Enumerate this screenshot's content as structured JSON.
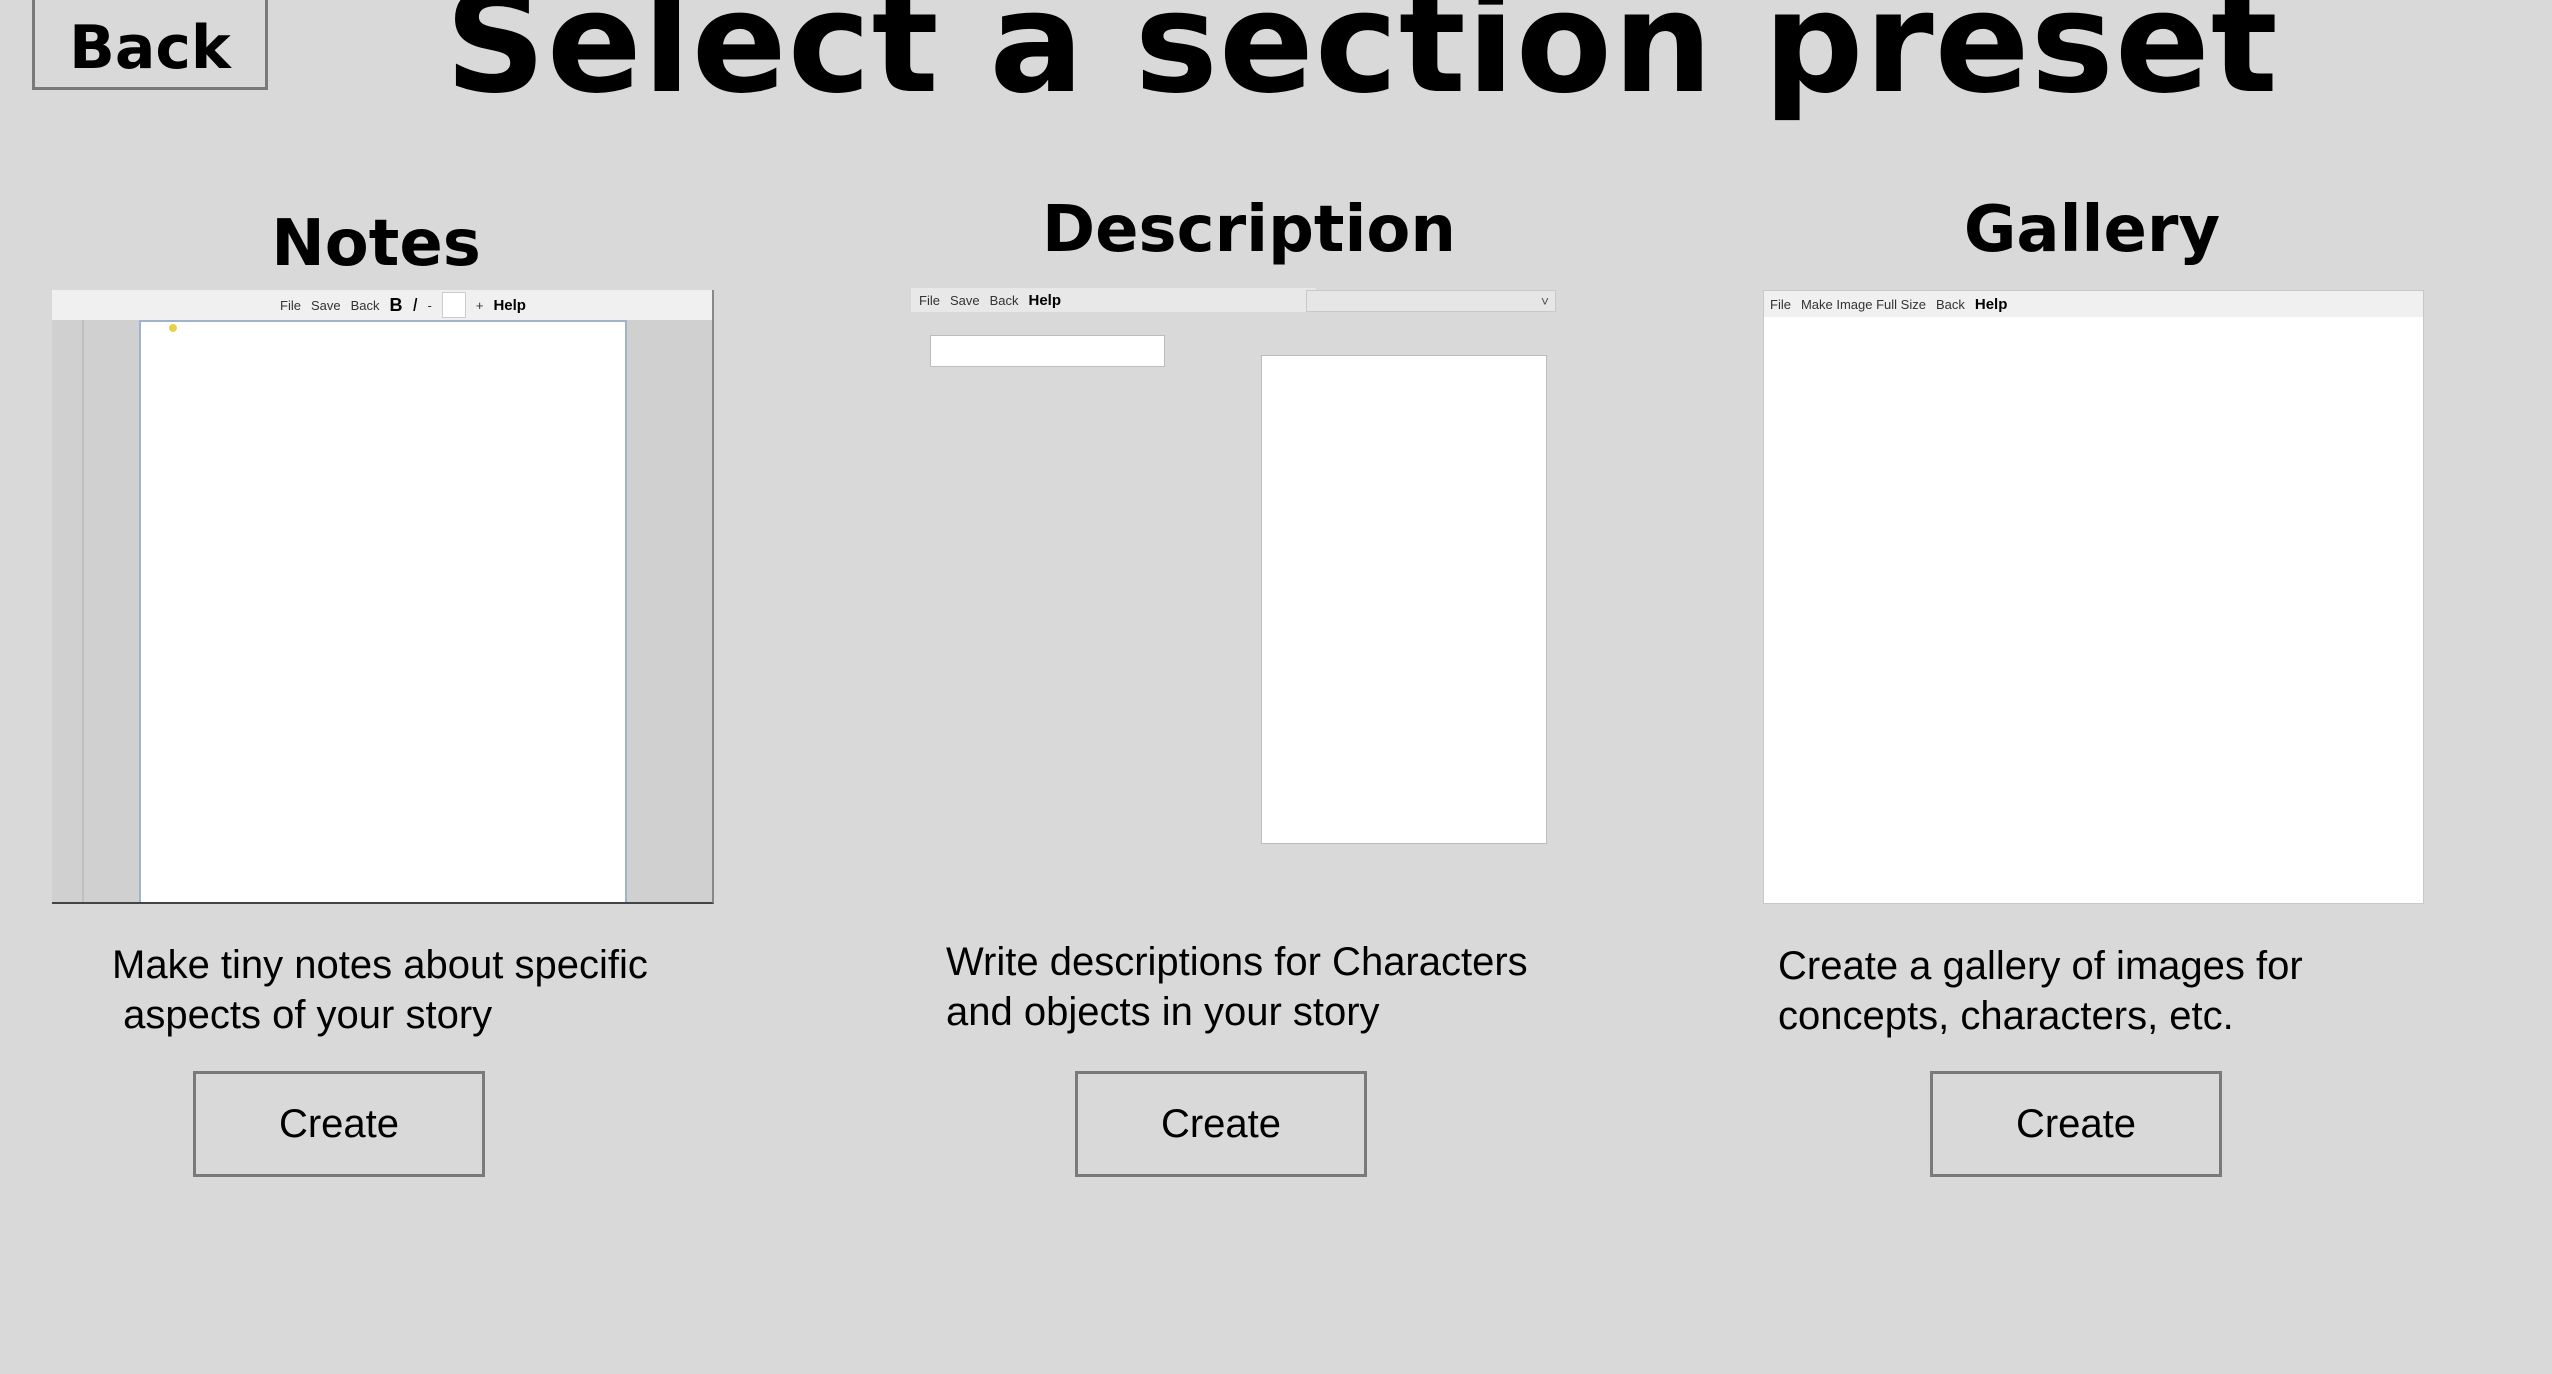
{
  "header": {
    "back_label": "Back",
    "title": "Select a section preset"
  },
  "presets": [
    {
      "title": "Notes",
      "toolbar": {
        "file": "File",
        "save": "Save",
        "back": "Back",
        "bold": "B",
        "italic": "I",
        "dash": "-",
        "plus": "+",
        "help": "Help"
      },
      "description": "Make tiny notes about specific\n aspects of your story",
      "create_label": "Create"
    },
    {
      "title": "Description",
      "toolbar": {
        "file": "File",
        "save": "Save",
        "back": "Back",
        "help": "Help",
        "dropdown_chevron": "˅"
      },
      "description": "Write descriptions for Characters\nand objects in your story",
      "create_label": "Create"
    },
    {
      "title": "Gallery",
      "toolbar": {
        "file": "File",
        "make_full": "Make Image Full Size",
        "back": "Back",
        "help": "Help"
      },
      "description": "Create a gallery of images for\nconcepts, characters, etc.",
      "create_label": "Create"
    }
  ]
}
